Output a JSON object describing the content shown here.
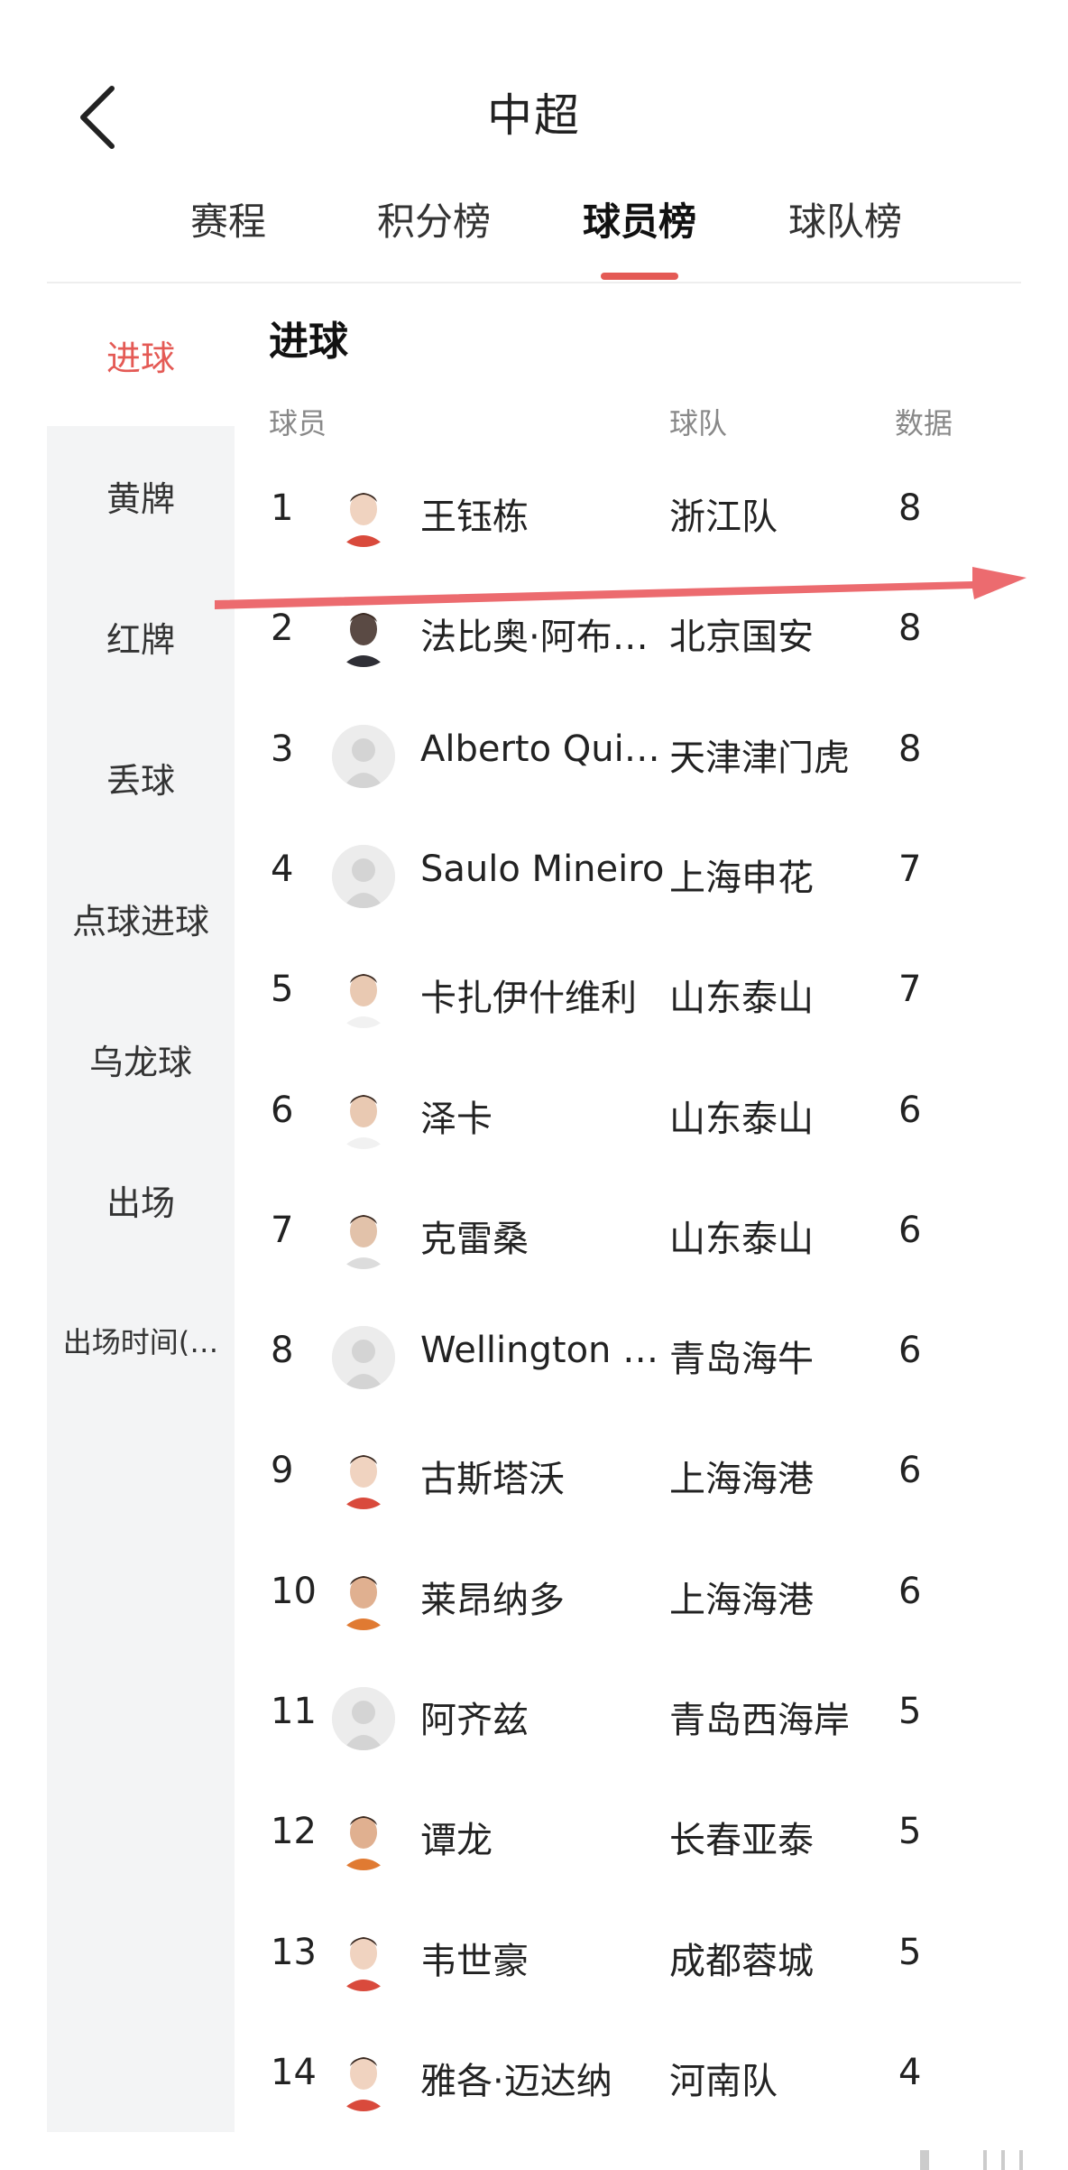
{
  "header": {
    "title": "中超"
  },
  "tabs": [
    {
      "label": "赛程"
    },
    {
      "label": "积分榜"
    },
    {
      "label": "球员榜"
    },
    {
      "label": "球队榜"
    }
  ],
  "sidebar": {
    "items": [
      {
        "label": "进球"
      },
      {
        "label": "黄牌"
      },
      {
        "label": "红牌"
      },
      {
        "label": "丢球"
      },
      {
        "label": "点球进球"
      },
      {
        "label": "乌龙球"
      },
      {
        "label": "出场"
      },
      {
        "label": "出场时间(…"
      }
    ]
  },
  "section": {
    "title": "进球"
  },
  "columns": {
    "player": "球员",
    "team": "球队",
    "data": "数据"
  },
  "rows": [
    {
      "rank": "1",
      "name": "王钰栋",
      "team": "浙江队",
      "value": "8",
      "avatar": "photo-red"
    },
    {
      "rank": "2",
      "name": "法比奥·阿布…",
      "team": "北京国安",
      "value": "8",
      "avatar": "photo-dark"
    },
    {
      "rank": "3",
      "name": "Alberto Quiles",
      "team": "天津津门虎",
      "value": "8",
      "avatar": "placeholder"
    },
    {
      "rank": "4",
      "name": "Saulo Mineiro",
      "team": "上海申花",
      "value": "7",
      "avatar": "placeholder"
    },
    {
      "rank": "5",
      "name": "卡扎伊什维利",
      "team": "山东泰山",
      "value": "7",
      "avatar": "photo-white"
    },
    {
      "rank": "6",
      "name": "泽卡",
      "team": "山东泰山",
      "value": "6",
      "avatar": "photo-white"
    },
    {
      "rank": "7",
      "name": "克雷桑",
      "team": "山东泰山",
      "value": "6",
      "avatar": "photo-light"
    },
    {
      "rank": "8",
      "name": "Wellington S…",
      "team": "青岛海牛",
      "value": "6",
      "avatar": "placeholder"
    },
    {
      "rank": "9",
      "name": "古斯塔沃",
      "team": "上海海港",
      "value": "6",
      "avatar": "photo-red"
    },
    {
      "rank": "10",
      "name": "莱昂纳多",
      "team": "上海海港",
      "value": "6",
      "avatar": "photo-orange"
    },
    {
      "rank": "11",
      "name": "阿齐兹",
      "team": "青岛西海岸",
      "value": "5",
      "avatar": "placeholder"
    },
    {
      "rank": "12",
      "name": "谭龙",
      "team": "长春亚泰",
      "value": "5",
      "avatar": "photo-orange"
    },
    {
      "rank": "13",
      "name": "韦世豪",
      "team": "成都蓉城",
      "value": "5",
      "avatar": "photo-red"
    },
    {
      "rank": "14",
      "name": "雅各·迈达纳",
      "team": "河南队",
      "value": "4",
      "avatar": "photo-red"
    }
  ],
  "colors": {
    "accent": "#e45a55",
    "arrow": "#ec6b6f",
    "sidebar_bg": "#f3f4f5",
    "muted": "#888888"
  },
  "icons": {
    "back": "chevron-left-icon",
    "avatar_placeholder": "person-silhouette-icon",
    "annotation": "arrow-right-icon"
  }
}
